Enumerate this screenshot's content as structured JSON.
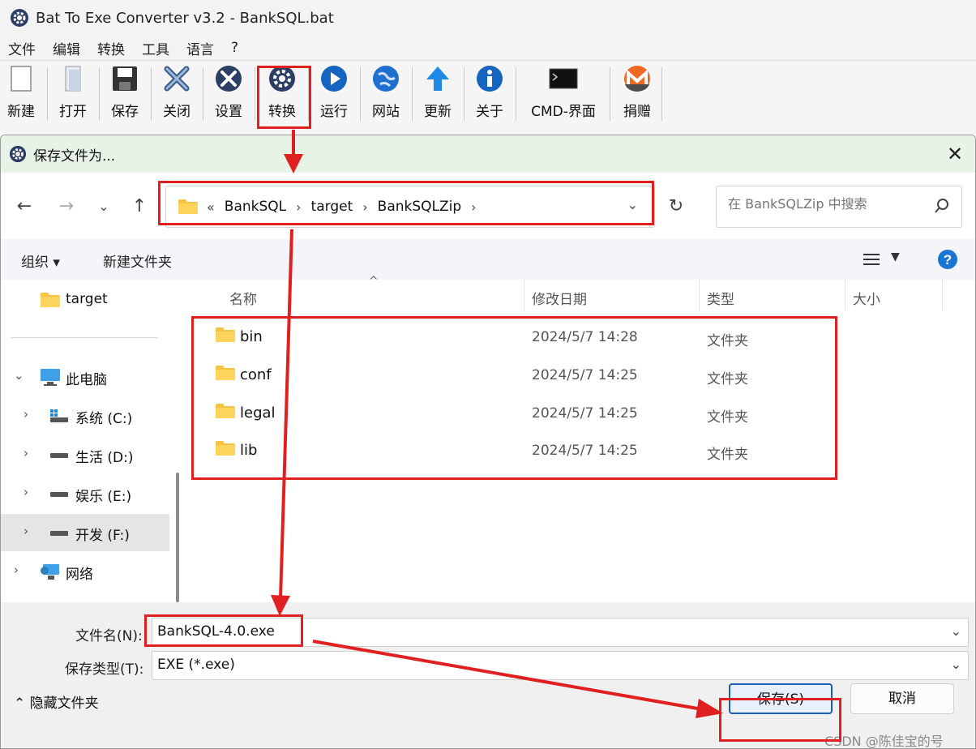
{
  "app": {
    "title": "Bat To Exe Converter v3.2 - BankSQL.bat",
    "menu": [
      "文件",
      "编辑",
      "转换",
      "工具",
      "语言",
      "?"
    ],
    "toolbar": [
      {
        "label": "新建",
        "icon": "new-document-icon"
      },
      {
        "label": "打开",
        "icon": "open-icon"
      },
      {
        "label": "保存",
        "icon": "floppy-disk-icon"
      },
      {
        "label": "关闭",
        "icon": "close-x-icon"
      },
      {
        "label": "设置",
        "icon": "tools-icon"
      },
      {
        "label": "转换",
        "icon": "gear-icon"
      },
      {
        "label": "运行",
        "icon": "play-icon"
      },
      {
        "label": "网站",
        "icon": "globe-icon"
      },
      {
        "label": "更新",
        "icon": "arrow-up-icon"
      },
      {
        "label": "关于",
        "icon": "info-icon"
      },
      {
        "label": "CMD-界面",
        "icon": "terminal-icon"
      },
      {
        "label": "捐赠",
        "icon": "monero-icon"
      }
    ]
  },
  "dialog": {
    "title": "保存文件为...",
    "breadcrumb": [
      "«",
      "BankSQL",
      "target",
      "BankSQLZip"
    ],
    "search_placeholder": "在 BankSQLZip 中搜索",
    "organize_label": "组织 ▾",
    "new_folder_label": "新建文件夹",
    "nav_tree": [
      {
        "label": "target",
        "icon": "folder-icon"
      },
      {
        "label": "此电脑",
        "icon": "computer-icon"
      },
      {
        "label": "系统 (C:)",
        "icon": "system-drive-icon"
      },
      {
        "label": "生活 (D:)",
        "icon": "drive-icon"
      },
      {
        "label": "娱乐 (E:)",
        "icon": "drive-icon"
      },
      {
        "label": "开发 (F:)",
        "icon": "drive-icon"
      },
      {
        "label": "网络",
        "icon": "network-icon"
      }
    ],
    "columns": [
      "名称",
      "修改日期",
      "类型",
      "大小"
    ],
    "files": [
      {
        "name": "bin",
        "date": "2024/5/7 14:28",
        "type": "文件夹"
      },
      {
        "name": "conf",
        "date": "2024/5/7 14:25",
        "type": "文件夹"
      },
      {
        "name": "legal",
        "date": "2024/5/7 14:25",
        "type": "文件夹"
      },
      {
        "name": "lib",
        "date": "2024/5/7 14:25",
        "type": "文件夹"
      }
    ],
    "filename_label": "文件名(N):",
    "filename_value": "BankSQL-4.0.exe",
    "filetype_label": "保存类型(T):",
    "filetype_value": "EXE (*.exe)",
    "hide_folders_label": "⌃ 隐藏文件夹",
    "save_button": "保存(S)",
    "cancel_button": "取消"
  },
  "watermark": "CSDN @陈佳宝的号",
  "colors": {
    "annotation": "#e02020",
    "dialog_title_bg": "#e6f3e6",
    "accent": "#1a5fb4",
    "folder": "#f5c542"
  }
}
